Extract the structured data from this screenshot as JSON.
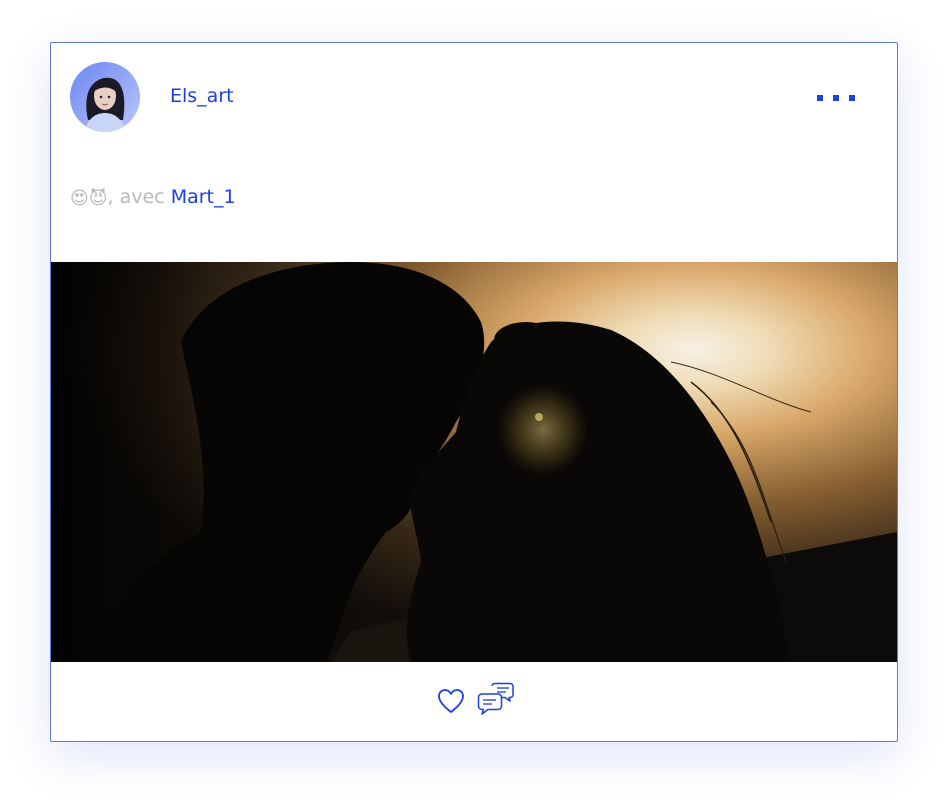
{
  "post": {
    "author": {
      "username": "Els_art",
      "avatar_icon": "profile-photo"
    },
    "menu_icon": "more-dots-icon",
    "caption": {
      "emojis": [
        "😍",
        "😈"
      ],
      "separator": ", avec",
      "mention": "Mart_1"
    },
    "photo": {
      "subject": "couple-silhouette-sunset"
    },
    "actions": {
      "like_icon": "heart-icon",
      "comment_icon": "comment-bubbles-icon"
    }
  },
  "colors": {
    "accent": "#1b3fe0",
    "border": "#5f7ae6",
    "muted_text": "#b9b9b9",
    "background": "#ffffff"
  }
}
